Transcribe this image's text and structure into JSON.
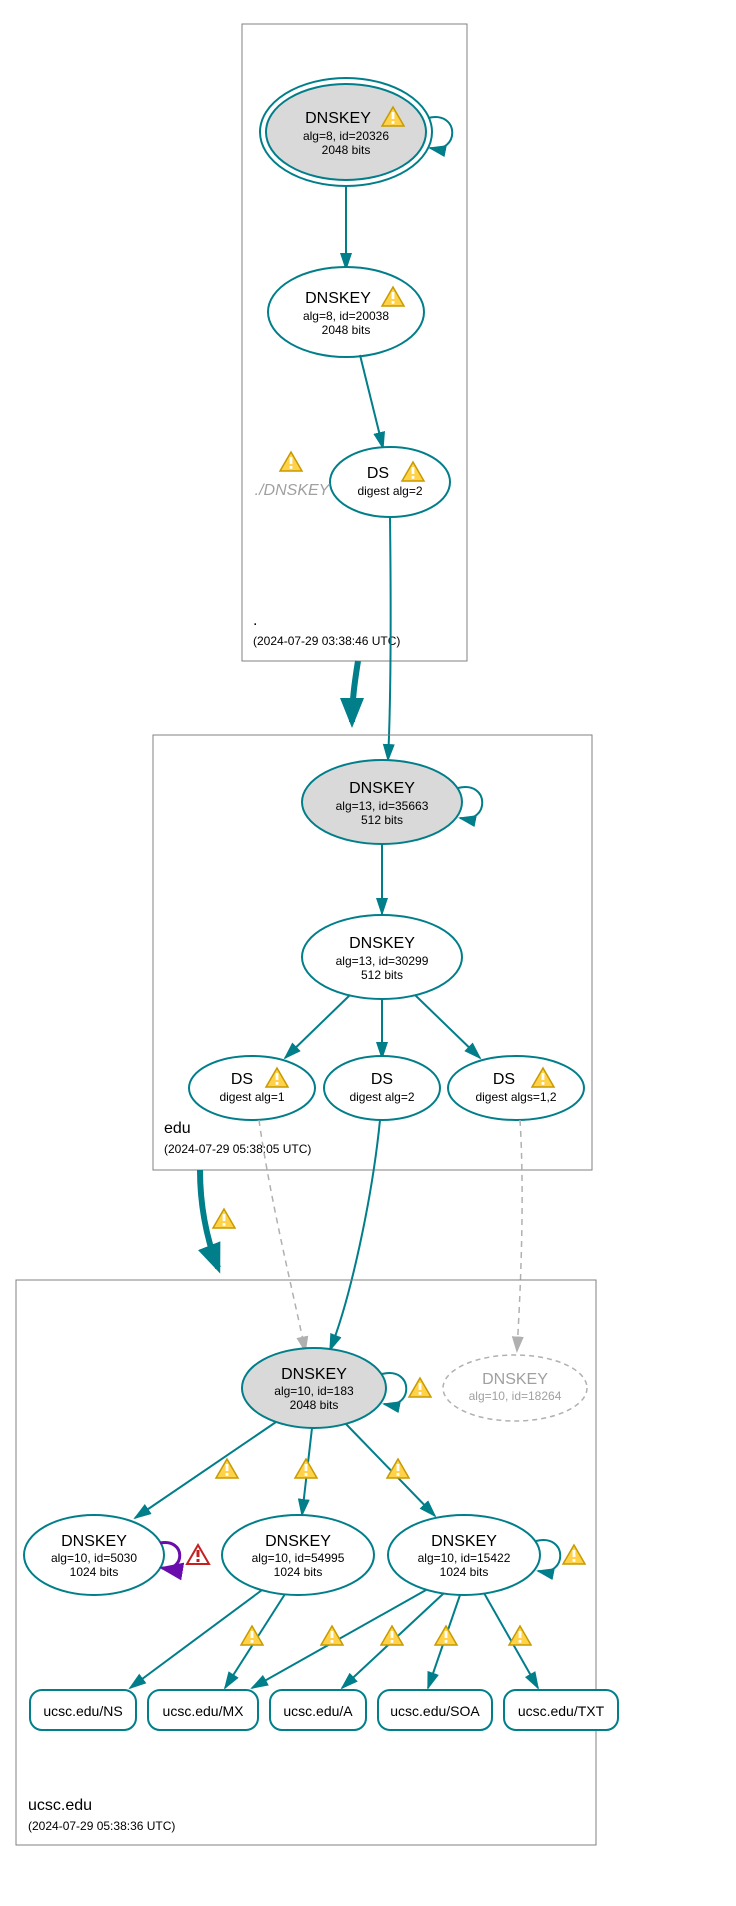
{
  "zones": {
    "root": {
      "label": ".",
      "date": "(2024-07-29 03:38:46 UTC)"
    },
    "edu": {
      "label": "edu",
      "date": "(2024-07-29 05:38:05 UTC)"
    },
    "ucsc": {
      "label": "ucsc.edu",
      "date": "(2024-07-29 05:38:36 UTC)"
    }
  },
  "nodes": {
    "root_key1": {
      "title": "DNSKEY",
      "line2": "alg=8, id=20326",
      "line3": "2048 bits"
    },
    "root_key2": {
      "title": "DNSKEY",
      "line2": "alg=8, id=20038",
      "line3": "2048 bits"
    },
    "root_ds": {
      "title": "DS",
      "line2": "digest alg=2"
    },
    "root_dnskey_italic": {
      "title": "./DNSKEY"
    },
    "edu_key1": {
      "title": "DNSKEY",
      "line2": "alg=13, id=35663",
      "line3": "512 bits"
    },
    "edu_key2": {
      "title": "DNSKEY",
      "line2": "alg=13, id=30299",
      "line3": "512 bits"
    },
    "edu_ds1": {
      "title": "DS",
      "line2": "digest alg=1"
    },
    "edu_ds2": {
      "title": "DS",
      "line2": "digest alg=2"
    },
    "edu_ds3": {
      "title": "DS",
      "line2": "digest algs=1,2"
    },
    "ucsc_key_main": {
      "title": "DNSKEY",
      "line2": "alg=10, id=183",
      "line3": "2048 bits"
    },
    "ucsc_key_dashed": {
      "title": "DNSKEY",
      "line2": "alg=10, id=18264"
    },
    "ucsc_key_5030": {
      "title": "DNSKEY",
      "line2": "alg=10, id=5030",
      "line3": "1024 bits"
    },
    "ucsc_key_54995": {
      "title": "DNSKEY",
      "line2": "alg=10, id=54995",
      "line3": "1024 bits"
    },
    "ucsc_key_15422": {
      "title": "DNSKEY",
      "line2": "alg=10, id=15422",
      "line3": "1024 bits"
    },
    "rr_ns": {
      "title": "ucsc.edu/NS"
    },
    "rr_mx": {
      "title": "ucsc.edu/MX"
    },
    "rr_a": {
      "title": "ucsc.edu/A"
    },
    "rr_soa": {
      "title": "ucsc.edu/SOA"
    },
    "rr_txt": {
      "title": "ucsc.edu/TXT"
    }
  }
}
